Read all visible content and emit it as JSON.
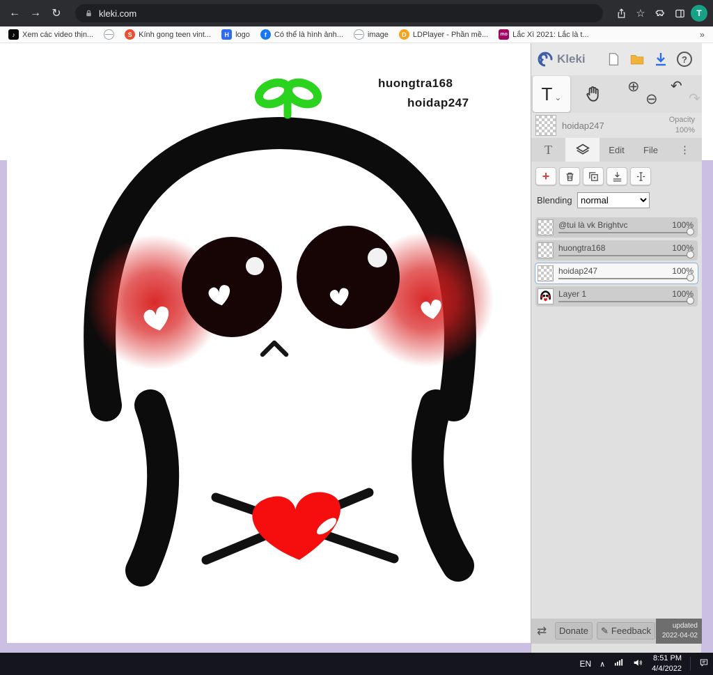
{
  "chrome": {
    "url": "kleki.com",
    "avatar_letter": "T",
    "icons": {
      "back": "←",
      "forward": "→",
      "reload": "↻",
      "star": "☆"
    }
  },
  "bookmarks_bar": {
    "items": [
      {
        "label": "Xem các video thịn...",
        "badge": "♪"
      },
      {
        "label": "",
        "badge": ""
      },
      {
        "label": "Kính gong teen vint...",
        "badge": "S"
      },
      {
        "label": "logo",
        "badge": "H"
      },
      {
        "label": "Có thể là hình ảnh...",
        "badge": "f"
      },
      {
        "label": "image",
        "badge": ""
      },
      {
        "label": "LDPlayer - Phần mề...",
        "badge": "D"
      },
      {
        "label": "Lắc Xì 2021: Lắc là t...",
        "badge": "mo"
      }
    ],
    "overflow": "»"
  },
  "canvas": {
    "text1": "huongtra168",
    "text2": "hoidap247"
  },
  "sidebar": {
    "brand": "Kleki",
    "help": "?",
    "tools": {
      "text_tool": "T",
      "caret": "⌄",
      "zoom_in": "⊕",
      "zoom_out": "⊖",
      "undo": "↶",
      "redo": "↷"
    },
    "current_layer": {
      "name": "hoidap247",
      "opacity_label": "Opacity",
      "opacity_value": "100%"
    },
    "tabs": {
      "text": "T",
      "edit": "Edit",
      "file": "File",
      "more": "⋮"
    },
    "layer_ops": {
      "add": "+"
    },
    "blending": {
      "label": "Blending",
      "value": "normal"
    },
    "layers": [
      {
        "name": "@tui là vk Brightvc",
        "opacity": "100%"
      },
      {
        "name": "huongtra168",
        "opacity": "100%"
      },
      {
        "name": "hoidap247",
        "opacity": "100%"
      },
      {
        "name": "Layer 1",
        "opacity": "100%"
      }
    ],
    "footer": {
      "swap": "⇄",
      "donate": "Donate",
      "pencil": "✎",
      "feedback": "Feedback",
      "updated_line1": "updated",
      "updated_line2": "2022-04-02"
    }
  },
  "taskbar": {
    "lang": "EN",
    "caret": "∧",
    "time": "8:51 PM",
    "date": "4/4/2022"
  },
  "colors": {
    "accent_blue": "#2d6fe0",
    "heart_red": "#f60d0d",
    "sprout_green": "#2bd31e",
    "blush_red": "#d81e1e"
  }
}
